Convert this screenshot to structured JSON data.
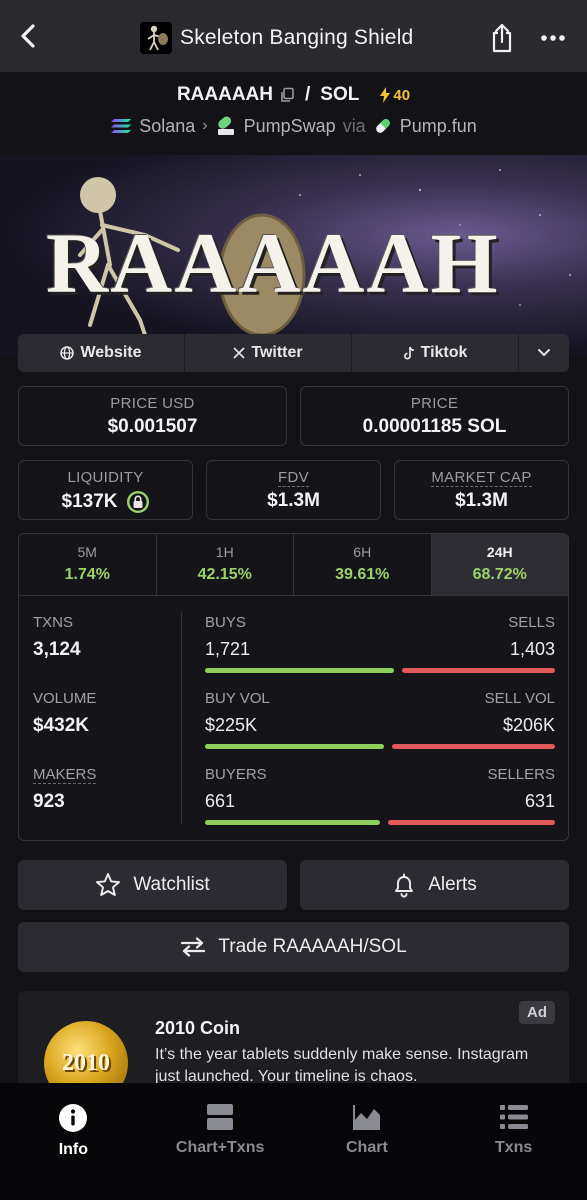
{
  "header": {
    "title": "Skeleton Banging Shield"
  },
  "pair": {
    "base": "RAAAAAH",
    "separator": "/",
    "quote": "SOL",
    "boost_count": "40"
  },
  "route": {
    "chain": "Solana",
    "dex": "PumpSwap",
    "via": "via",
    "launchpad": "Pump.fun"
  },
  "banner": {
    "text": "RAAAAAH"
  },
  "links": {
    "website": "Website",
    "twitter": "Twitter",
    "tiktok": "Tiktok"
  },
  "prices": {
    "usd_label": "PRICE USD",
    "usd_value": "$0.001507",
    "native_label": "PRICE",
    "native_value": "0.00001185 SOL"
  },
  "metrics": {
    "liquidity_label": "LIQUIDITY",
    "liquidity_value": "$137K",
    "fdv_label": "FDV",
    "fdv_value": "$1.3M",
    "mcap_label": "MARKET CAP",
    "mcap_value": "$1.3M"
  },
  "timeframes": [
    {
      "label": "5M",
      "change": "1.74%"
    },
    {
      "label": "1H",
      "change": "42.15%"
    },
    {
      "label": "6H",
      "change": "39.61%"
    },
    {
      "label": "24H",
      "change": "68.72%"
    }
  ],
  "stats": {
    "txns_label": "TXNS",
    "txns_value": "3,124",
    "volume_label": "VOLUME",
    "volume_value": "$432K",
    "makers_label": "MAKERS",
    "makers_value": "923",
    "buys_label": "BUYS",
    "buys_value": "1,721",
    "sells_label": "SELLS",
    "sells_value": "1,403",
    "buys_ratio": 0.551,
    "buyvol_label": "BUY VOL",
    "buyvol_value": "$225K",
    "sellvol_label": "SELL VOL",
    "sellvol_value": "$206K",
    "buyvol_ratio": 0.522,
    "buyers_label": "BUYERS",
    "buyers_value": "661",
    "sellers_label": "SELLERS",
    "sellers_value": "631",
    "buyers_ratio": 0.512
  },
  "actions": {
    "watchlist": "Watchlist",
    "alerts": "Alerts",
    "trade": "Trade RAAAAAH/SOL"
  },
  "ad": {
    "badge": "Ad",
    "title": "2010 Coin",
    "body": "It’s the year tablets suddenly make sense. Instagram just launched. Your timeline is chaos.",
    "logo_text": "2010"
  },
  "nav": {
    "info": "Info",
    "chart_txns": "Chart+Txns",
    "chart": "Chart",
    "txns": "Txns"
  },
  "colors": {
    "positive": "#9bd26a",
    "buy_bar": "#8ccf5a",
    "sell_bar": "#e2595a",
    "boost": "#f2c233"
  }
}
